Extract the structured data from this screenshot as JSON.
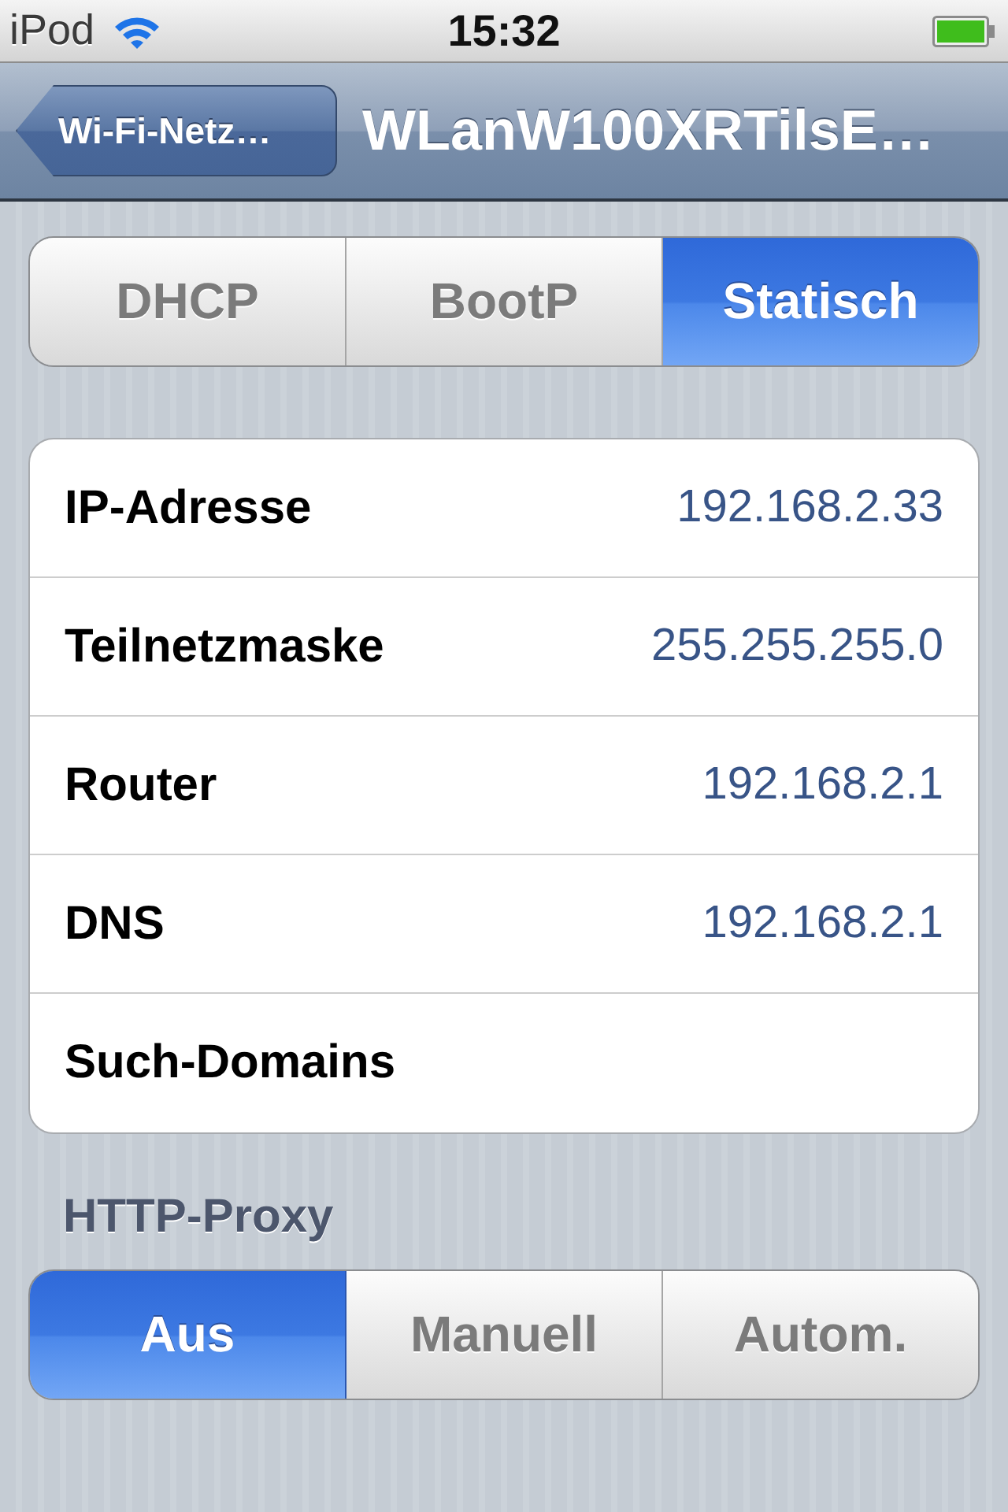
{
  "status_bar": {
    "carrier": "iPod",
    "time": "15:32"
  },
  "nav_bar": {
    "back_button": "Wi-Fi-Netz…",
    "title": "WLanW100XRTilsE…"
  },
  "mode_tabs": [
    {
      "label": "DHCP",
      "selected": false
    },
    {
      "label": "BootP",
      "selected": false
    },
    {
      "label": "Statisch",
      "selected": true
    }
  ],
  "fields": [
    {
      "label": "IP-Adresse",
      "value": "192.168.2.33"
    },
    {
      "label": "Teilnetzmaske",
      "value": "255.255.255.0"
    },
    {
      "label": "Router",
      "value": "192.168.2.1"
    },
    {
      "label": "DNS",
      "value": "192.168.2.1"
    },
    {
      "label": "Such-Domains"
    }
  ],
  "proxy": {
    "header": "HTTP-Proxy",
    "tabs": [
      {
        "label": "Aus",
        "selected": true
      },
      {
        "label": "Manuell",
        "selected": false
      },
      {
        "label": "Autom.",
        "selected": false
      }
    ]
  }
}
